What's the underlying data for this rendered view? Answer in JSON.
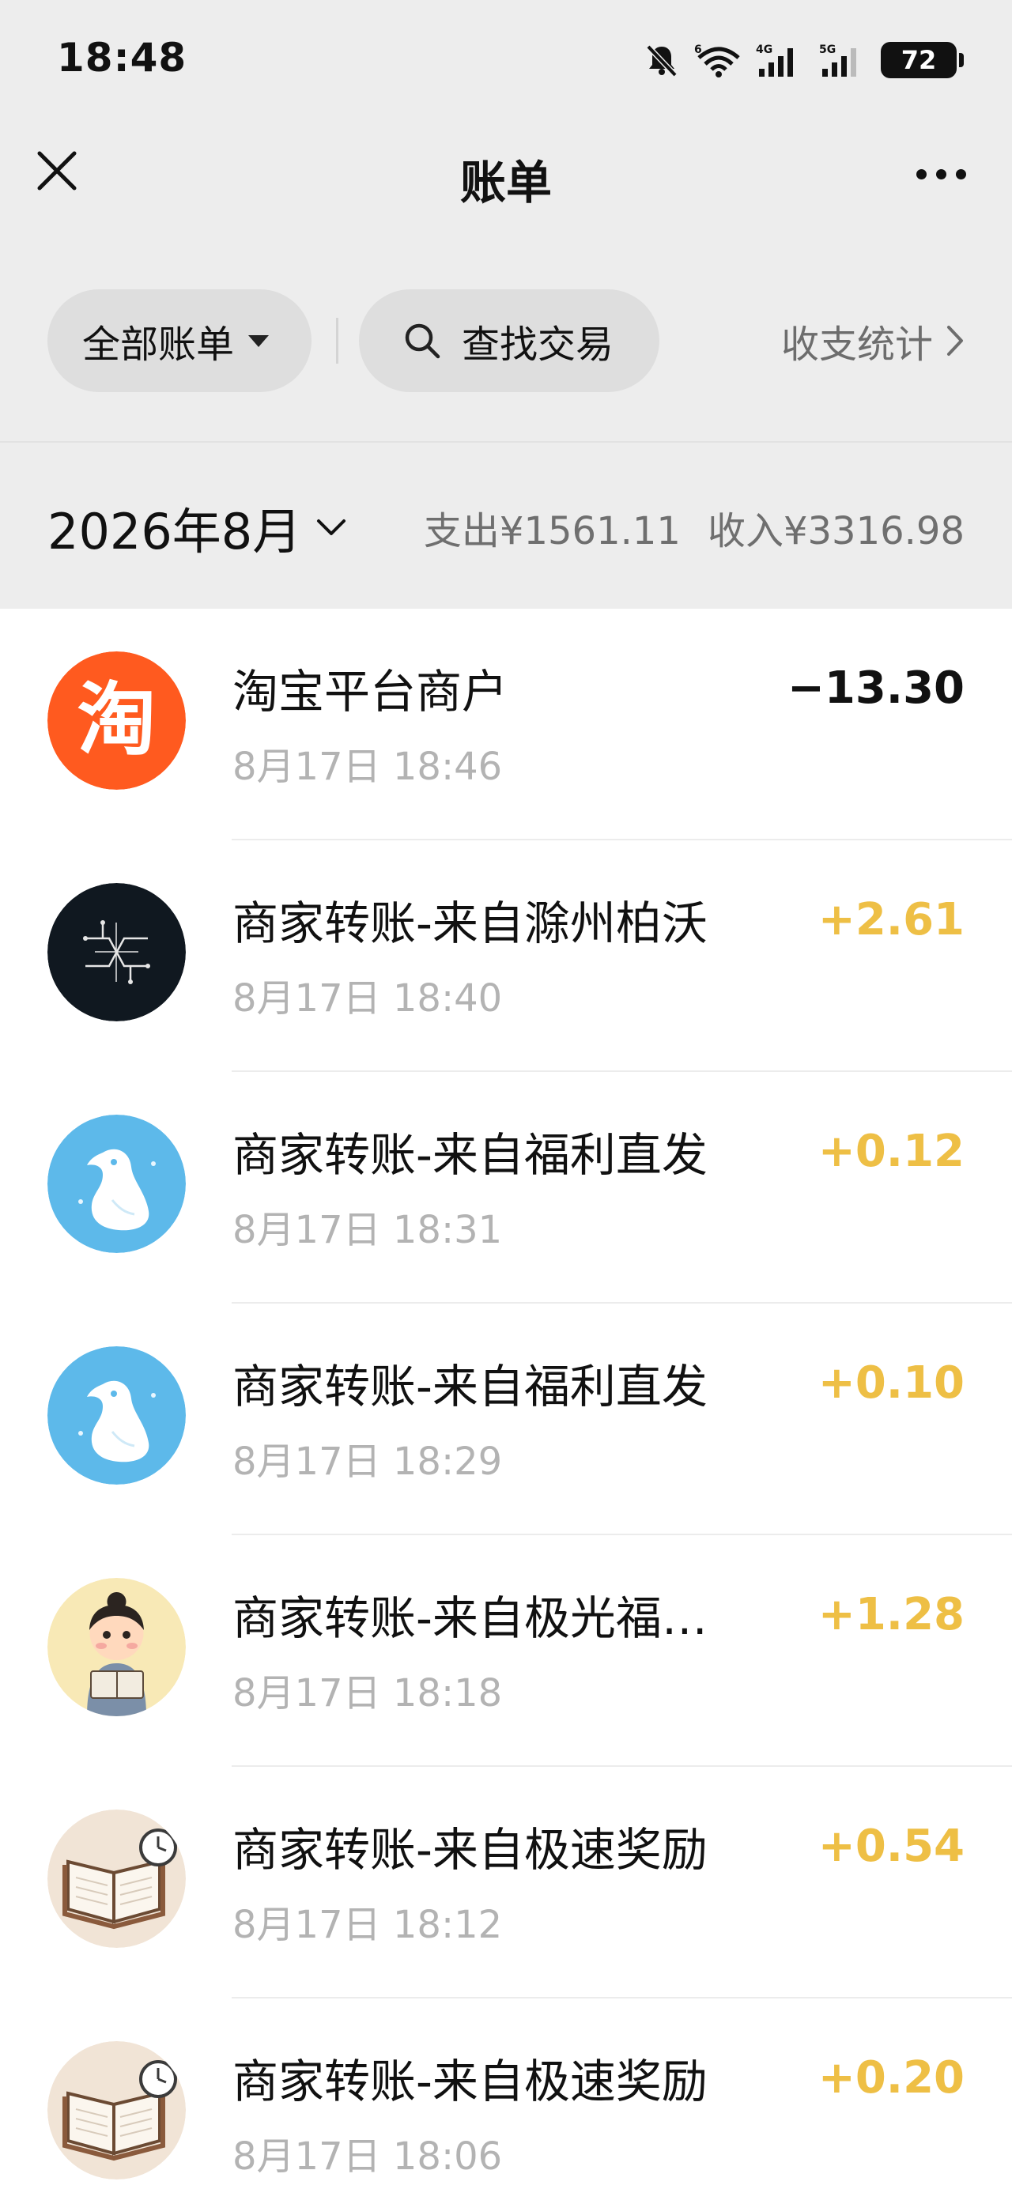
{
  "status_bar": {
    "time": "18:48",
    "icons": [
      "bell-muted-icon",
      "wifi-icon",
      "signal-4g-icon",
      "signal-5g-icon"
    ],
    "battery": "72"
  },
  "header": {
    "title": "账单",
    "close_icon": "close-icon",
    "more_icon": "more-icon"
  },
  "filters": {
    "all_bills_label": "全部账单",
    "search_label": "查找交易",
    "stats_label": "收支统计"
  },
  "month": {
    "label": "2026年8月",
    "expense_label": "支出¥1561.11",
    "income_label": "收入¥3316.98"
  },
  "colors": {
    "background": "#ededed",
    "income_amount": "#eebf45",
    "expense_amount": "#111111",
    "taobao_orange": "#ff5a1f"
  },
  "transactions": [
    {
      "name": "淘宝平台商户",
      "time": "8月17日 18:46",
      "amount": "−13.30",
      "type": "expense",
      "icon": "taobao-logo-icon"
    },
    {
      "name": "商家转账-来自滁州柏沃",
      "time": "8月17日 18:40",
      "amount": "+2.61",
      "type": "income",
      "icon": "circuit-logo-icon"
    },
    {
      "name": "商家转账-来自福利直发",
      "time": "8月17日 18:31",
      "amount": "+0.12",
      "type": "income",
      "icon": "penguin-logo-icon"
    },
    {
      "name": "商家转账-来自福利直发",
      "time": "8月17日 18:29",
      "amount": "+0.10",
      "type": "income",
      "icon": "penguin-logo-icon"
    },
    {
      "name": "商家转账-来自极光福…",
      "time": "8月17日 18:18",
      "amount": "+1.28",
      "type": "income",
      "icon": "reading-child-icon"
    },
    {
      "name": "商家转账-来自极速奖励",
      "time": "8月17日 18:12",
      "amount": "+0.54",
      "type": "income",
      "icon": "book-clock-icon"
    },
    {
      "name": "商家转账-来自极速奖励",
      "time": "8月17日 18:06",
      "amount": "+0.20",
      "type": "income",
      "icon": "book-clock-icon"
    }
  ]
}
